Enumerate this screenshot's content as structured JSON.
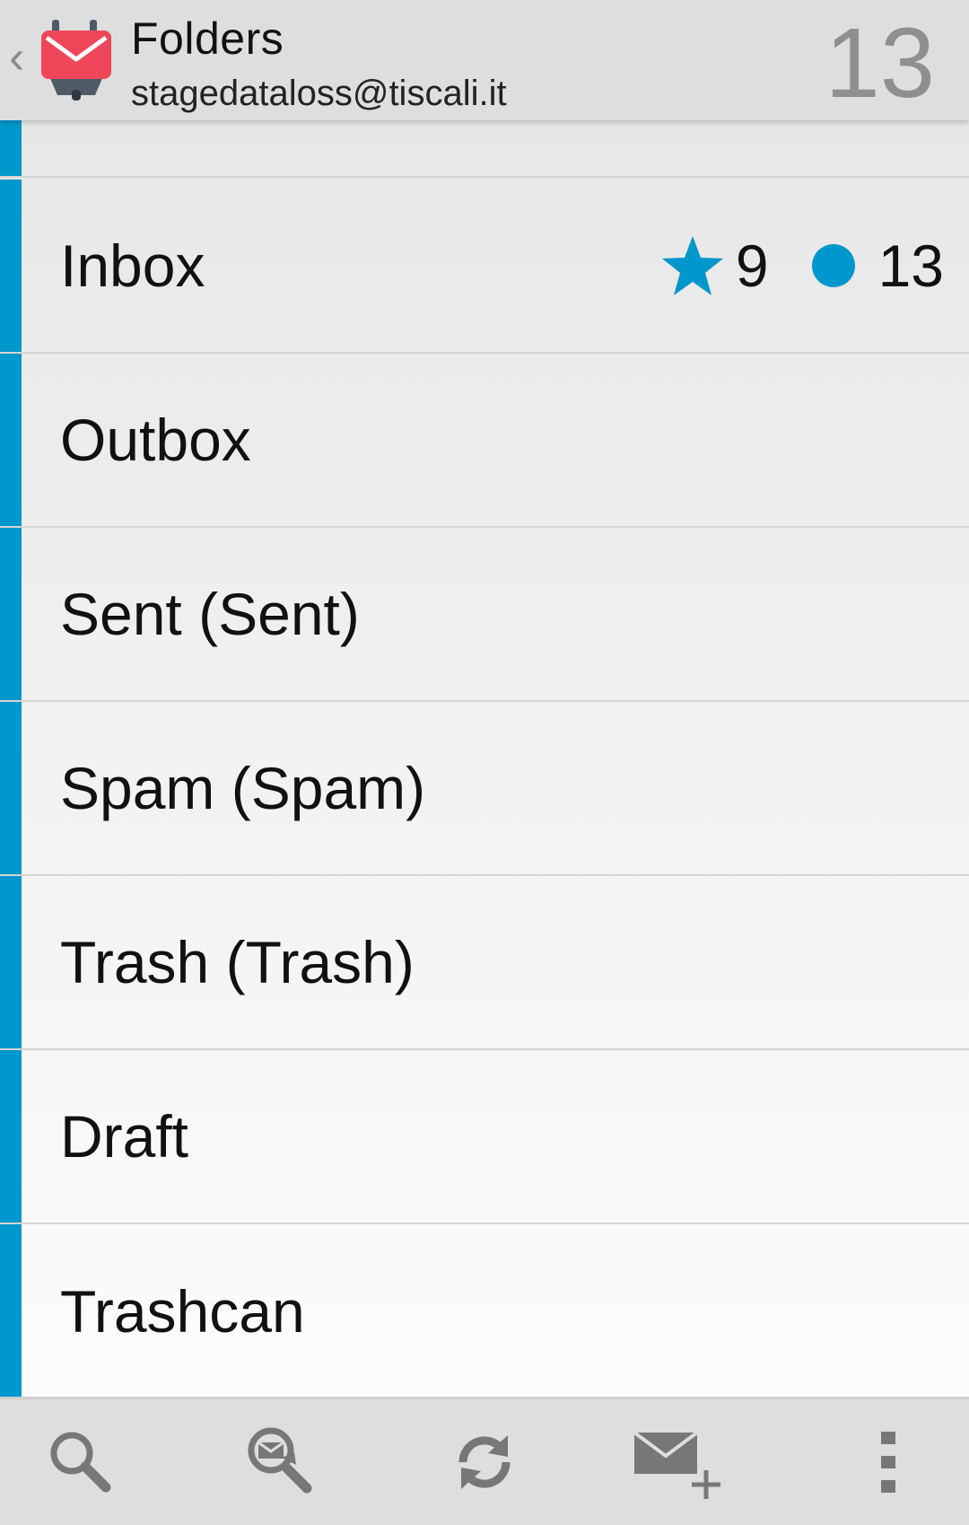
{
  "header": {
    "title": "Folders",
    "account": "stagedataloss@tiscali.it",
    "unread_count": "13"
  },
  "folders": [
    {
      "name": "Inbox",
      "flagged_count": "9",
      "unread_count": "13"
    },
    {
      "name": "Outbox"
    },
    {
      "name": "Sent (Sent)"
    },
    {
      "name": "Spam (Spam)"
    },
    {
      "name": "Trash (Trash)"
    },
    {
      "name": "Draft"
    },
    {
      "name": "Trashcan"
    }
  ],
  "bottom_actions": [
    {
      "name": "search",
      "icon": "search-icon"
    },
    {
      "name": "search-remote",
      "icon": "search-messages-icon"
    },
    {
      "name": "refresh",
      "icon": "refresh-icon"
    },
    {
      "name": "compose",
      "icon": "compose-mail-icon"
    },
    {
      "name": "overflow-menu",
      "icon": "more-vert-icon"
    }
  ],
  "colors": {
    "accent": "#0097cc",
    "bar_background": "#dedede",
    "app_icon_red": "#f0465a"
  }
}
